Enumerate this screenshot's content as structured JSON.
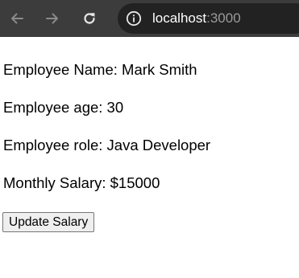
{
  "browser": {
    "url_host": "localhost",
    "url_port": ":3000",
    "back_icon": "arrow-left-icon",
    "forward_icon": "arrow-right-icon",
    "reload_icon": "reload-icon",
    "site_info_icon": "info-icon"
  },
  "employee": {
    "name_line": "Employee Name: Mark Smith",
    "age_line": "Employee age: 30",
    "role_line": "Employee role: Java Developer",
    "salary_line": "Monthly Salary: $15000"
  },
  "actions": {
    "update_salary_label": "Update Salary"
  },
  "colors": {
    "toolbar_bg": "#3c3c3c",
    "address_bg": "#222222",
    "page_bg": "#ffffff",
    "button_bg": "#efefef"
  }
}
